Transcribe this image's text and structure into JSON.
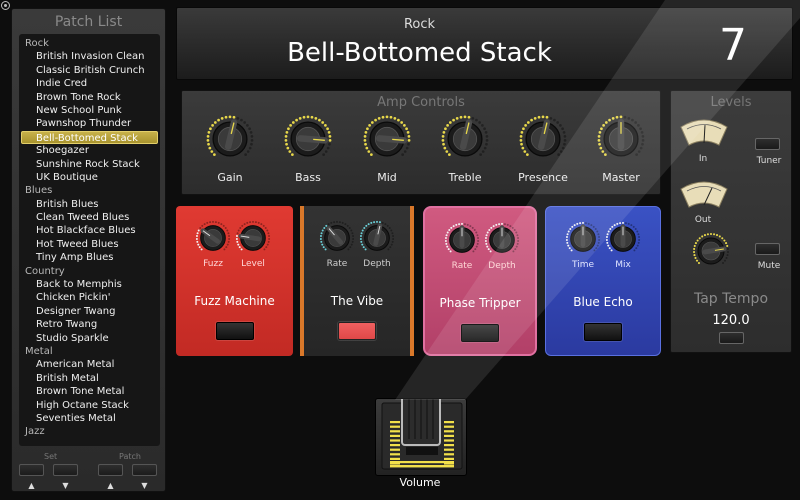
{
  "window": {
    "close_icon": "close-circle-icon"
  },
  "sidebar": {
    "title": "Patch List",
    "categories": [
      {
        "name": "Rock",
        "items": [
          "British Invasion Clean",
          "Classic British Crunch",
          "Indie Cred",
          "Brown Tone Rock",
          "New School Punk",
          "Pawnshop Thunder",
          "Bell-Bottomed Stack",
          "Shoegazer",
          "Sunshine Rock Stack",
          "UK Boutique"
        ]
      },
      {
        "name": "Blues",
        "items": [
          "British Blues",
          "Clean Tweed Blues",
          "Hot Blackface Blues",
          "Hot Tweed Blues",
          "Tiny Amp Blues"
        ]
      },
      {
        "name": "Country",
        "items": [
          "Back to Memphis",
          "Chicken Pickin'",
          "Designer Twang",
          "Retro Twang",
          "Studio Sparkle"
        ]
      },
      {
        "name": "Metal",
        "items": [
          "American Metal",
          "British Metal",
          "Brown Tone Metal",
          "High Octane Stack",
          "Seventies Metal"
        ]
      },
      {
        "name": "Jazz",
        "items": []
      }
    ],
    "selected": "Bell-Bottomed Stack",
    "set_label": "Set",
    "patch_label": "Patch",
    "up_arrow": "▲",
    "down_arrow": "▼"
  },
  "header": {
    "category": "Rock",
    "patch_name": "Bell-Bottomed Stack",
    "patch_number": "7"
  },
  "amp_controls": {
    "title": "Amp Controls",
    "knobs": [
      {
        "label": "Gain",
        "value": 0.55
      },
      {
        "label": "Bass",
        "value": 0.85
      },
      {
        "label": "Mid",
        "value": 0.85
      },
      {
        "label": "Treble",
        "value": 0.55
      },
      {
        "label": "Presence",
        "value": 0.55
      },
      {
        "label": "Master",
        "value": 0.5
      }
    ]
  },
  "levels": {
    "title": "Levels",
    "in_label": "In",
    "out_label": "Out",
    "tuner_label": "Tuner",
    "mute_label": "Mute",
    "output_knob_value": 0.8,
    "tap_tempo_label": "Tap Tempo",
    "tempo": "120.0"
  },
  "pedals": [
    {
      "name": "Fuzz Machine",
      "knobs": [
        {
          "label": "Fuzz",
          "value": 0.3
        },
        {
          "label": "Level",
          "value": 0.2
        }
      ],
      "color": "#d9332e",
      "active": false
    },
    {
      "name": "The Vibe",
      "knobs": [
        {
          "label": "Rate",
          "value": 0.35
        },
        {
          "label": "Depth",
          "value": 0.55
        }
      ],
      "color": "#2c2c2c",
      "active": true
    },
    {
      "name": "Phase Tripper",
      "knobs": [
        {
          "label": "Rate",
          "value": 0.5
        },
        {
          "label": "Depth",
          "value": 0.5
        }
      ],
      "color": "#c24a72",
      "active": false
    },
    {
      "name": "Blue Echo",
      "knobs": [
        {
          "label": "Time",
          "value": 0.5
        },
        {
          "label": "Mix",
          "value": 0.5
        }
      ],
      "color": "#3345b0",
      "active": false
    }
  ],
  "volume": {
    "label": "Volume",
    "value": 1.0
  },
  "colors": {
    "accent": "#e8d84a",
    "selected": "#b9a23a",
    "vibe_led": "#e04848"
  }
}
